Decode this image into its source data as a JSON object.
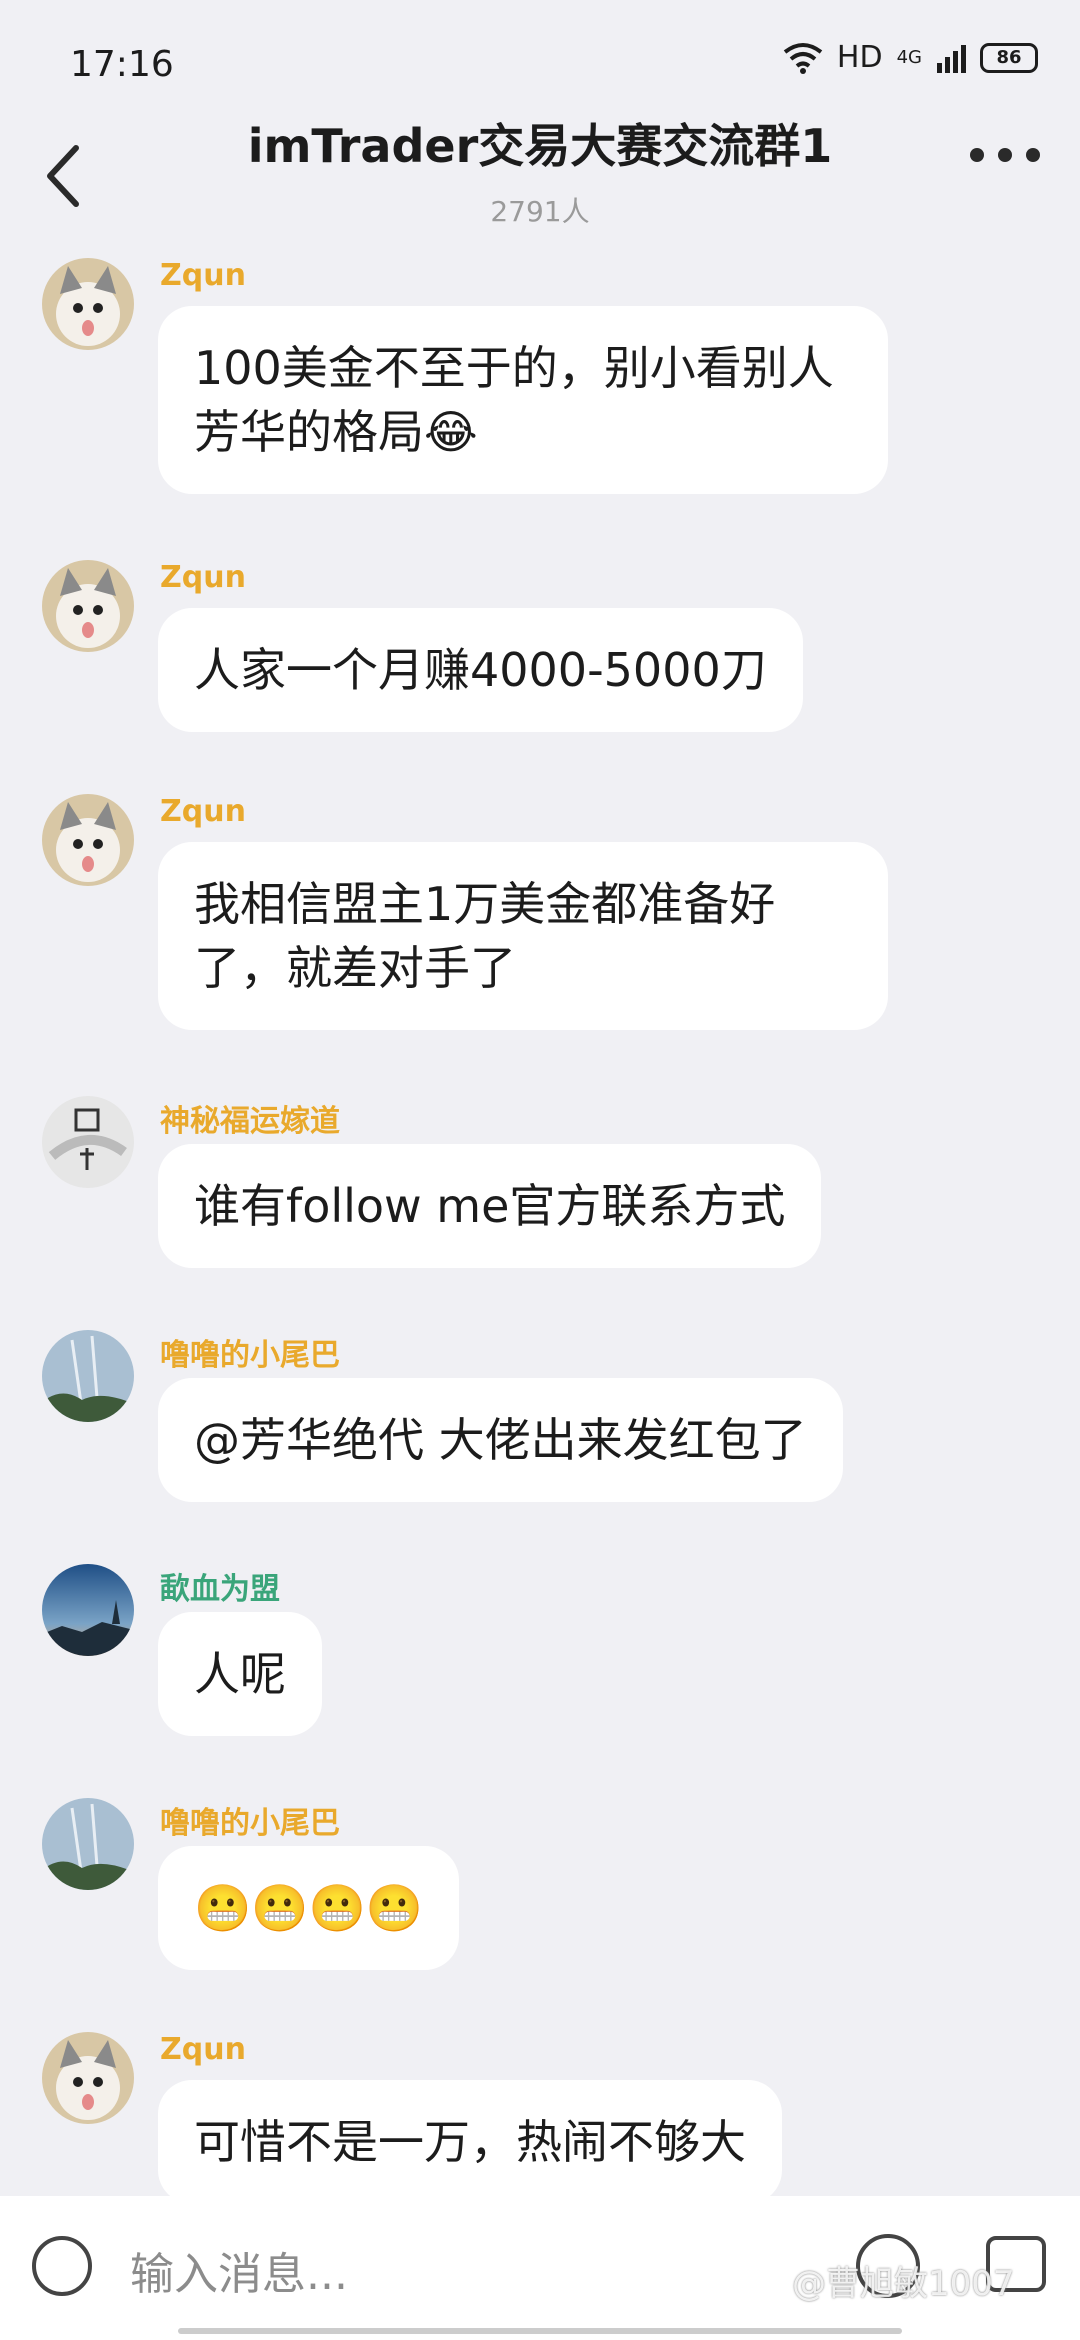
{
  "status": {
    "time": "17:16",
    "network": "HD",
    "signal": "4G",
    "battery": "86"
  },
  "header": {
    "title": "imTrader交易大赛交流群1",
    "member_count": "2791人"
  },
  "messages": [
    {
      "sender": "Zqun",
      "sender_color": "#e9a92c",
      "text": "100美金不至于的，别小看别人芳华的格局😂"
    },
    {
      "sender": "Zqun",
      "sender_color": "#e9a92c",
      "text": "人家一个月赚4000-5000刀"
    },
    {
      "sender": "Zqun",
      "sender_color": "#e9a92c",
      "text": "我相信盟主1万美金都准备好了，就差对手了"
    },
    {
      "sender": "神秘福运嫁道",
      "sender_color": "#e9a92c",
      "text": "谁有follow me官方联系方式"
    },
    {
      "sender": "噜噜的小尾巴",
      "sender_color": "#e9a92c",
      "text": "@芳华绝代 大佬出来发红包了"
    },
    {
      "sender": "歃血为盟",
      "sender_color": "#3aa57a",
      "text": "人呢"
    },
    {
      "sender": "噜噜的小尾巴",
      "sender_color": "#e9a92c",
      "text": "😬😬😬😬"
    },
    {
      "sender": "Zqun",
      "sender_color": "#e9a92c",
      "text": "可惜不是一万，热闹不够大"
    }
  ],
  "input": {
    "placeholder": "输入消息..."
  },
  "watermark": "@曹旭敏1007"
}
